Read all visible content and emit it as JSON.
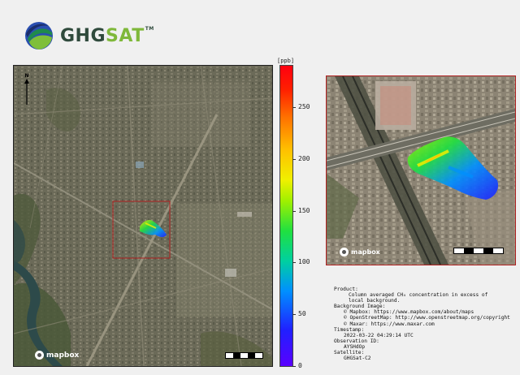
{
  "logo": {
    "text_part1": "GHG",
    "text_part2": "SAT",
    "tm": "TM"
  },
  "colorbar": {
    "unit": "[ppb]",
    "ticks": [
      {
        "value": "0",
        "frac": 0.0
      },
      {
        "value": "50",
        "frac": 0.1724
      },
      {
        "value": "100",
        "frac": 0.3448
      },
      {
        "value": "150",
        "frac": 0.5172
      },
      {
        "value": "200",
        "frac": 0.6897
      },
      {
        "value": "250",
        "frac": 0.8621
      }
    ],
    "colors": [
      "#5a00ff",
      "#2020ff",
      "#0090ff",
      "#20e040",
      "#f0f000",
      "#ff7000",
      "#ff0010"
    ]
  },
  "main_map": {
    "north_label": "N",
    "attribution": "mapbox"
  },
  "zoom_map": {
    "attribution": "mapbox"
  },
  "info": {
    "product_heading": "Product:",
    "product_line1": "Column averaged CH₄ concentration in excess of",
    "product_line2": "local background.",
    "background_heading": "Background Image:",
    "bg_mapbox": "© Mapbox: https://www.mapbox.com/about/maps",
    "bg_osm": "© OpenStreetMap: http://www.openstreetmap.org/copyright",
    "bg_maxar": "© Maxar: https://www.maxar.com",
    "timestamp_heading": "Timestamp:",
    "timestamp": "2022-03-22 04:29:14 UTC",
    "obs_heading": "Observation ID:",
    "obs_id": "AYSHdOp",
    "sat_heading": "Satellite:",
    "satellite": "GHGSat-C2"
  }
}
